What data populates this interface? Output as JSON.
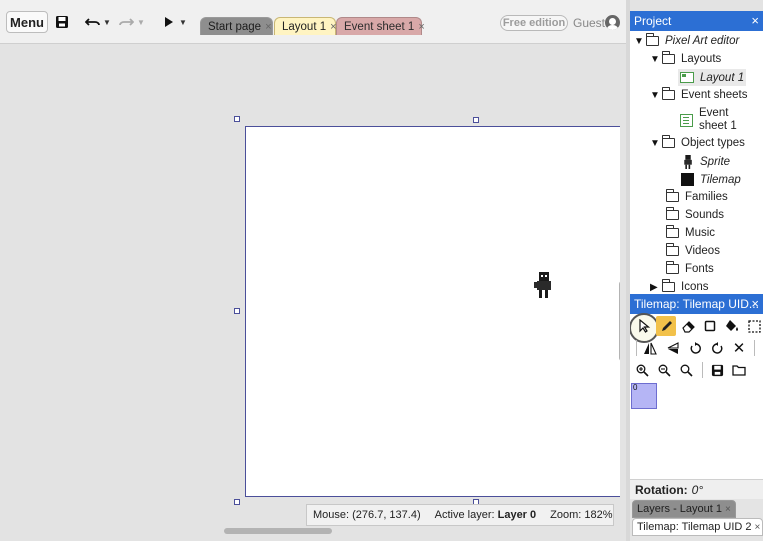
{
  "toolbar": {
    "menu_label": "Menu",
    "save_icon": "save-icon",
    "undo_icon": "undo-icon",
    "redo_icon": "redo-icon",
    "play_icon": "play-icon"
  },
  "tabs": [
    {
      "label": "Start page",
      "close": "×"
    },
    {
      "label": "Layout 1",
      "close": "×"
    },
    {
      "label": "Event sheet 1",
      "close": "×"
    }
  ],
  "account": {
    "edition_badge": "Free edition",
    "user": "Guest"
  },
  "statusbar": {
    "mouse": "Mouse: (276.7, 137.4)",
    "active_layer_label": "Active layer:",
    "active_layer_value": "Layer 0",
    "zoom": "Zoom: 182%"
  },
  "project_panel": {
    "title": "Project",
    "close": "×",
    "root": "Pixel Art editor",
    "layouts_folder": "Layouts",
    "layout_item": "Layout 1",
    "event_sheets_folder": "Event sheets",
    "event_item_line1": "Event",
    "event_item_line2": "sheet 1",
    "object_types_folder": "Object types",
    "sprite_item": "Sprite",
    "tilemap_item": "Tilemap",
    "families": "Families",
    "sounds": "Sounds",
    "music": "Music",
    "videos": "Videos",
    "fonts": "Fonts",
    "icons": "Icons"
  },
  "tilemap_panel": {
    "title": "Tilemap: Tilemap UID...",
    "close": "×",
    "tile_index": "0"
  },
  "rotation": {
    "label": "Rotation:",
    "value": "0°"
  },
  "dock_tabs": {
    "layers": "Layers - Layout 1",
    "tilemap": "Tilemap: Tilemap UID 2",
    "close": "×"
  },
  "colors": {
    "panel_header": "#2c6fd4",
    "canvas_border": "#4b4f9a",
    "active_tool": "#f2c14a",
    "tile_swatch": "#b5b5f5"
  }
}
